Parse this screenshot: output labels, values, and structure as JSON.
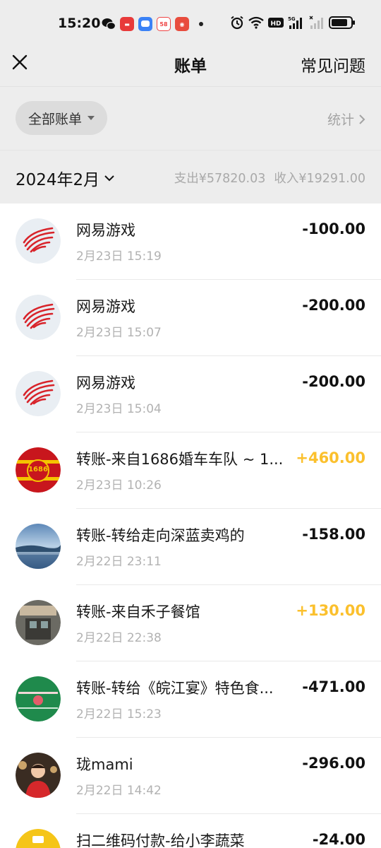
{
  "status_bar": {
    "time": "15:20",
    "left_icons": [
      "wechat-icon",
      "toutiao-icon",
      "message-icon",
      "58-app-icon",
      "weibo-icon"
    ],
    "right_icons": [
      "alarm-icon",
      "wifi-icon",
      "hd-icon",
      "signal-5g-icon",
      "signal-icon",
      "battery-icon"
    ],
    "hd_label": "HD",
    "fiveg_label": "5G",
    "battery_level": 0.85
  },
  "nav": {
    "title": "账单",
    "right_action": "常见问题"
  },
  "filter": {
    "chip_label": "全部账单",
    "stats_label": "统计"
  },
  "month": {
    "label": "2024年2月",
    "expense": "支出¥57820.03",
    "income": "收入¥19291.00"
  },
  "colors": {
    "background": "#ffffff",
    "header_bg": "#ededed",
    "income_amount": "#fbc02d",
    "netease_red": "#d8232a"
  },
  "bills": [
    {
      "title": "网易游戏",
      "time": "2月23日 15:19",
      "amount": "-100.00",
      "type": "expense",
      "avatar": "netease-logo"
    },
    {
      "title": "网易游戏",
      "time": "2月23日 15:07",
      "amount": "-200.00",
      "type": "expense",
      "avatar": "netease-logo"
    },
    {
      "title": "网易游戏",
      "time": "2月23日 15:04",
      "amount": "-200.00",
      "type": "expense",
      "avatar": "netease-logo"
    },
    {
      "title": "转账-来自1686婚车车队 ~ 1...",
      "time": "2月23日 10:26",
      "amount": "+460.00",
      "type": "income",
      "avatar": "wedding-car-avatar",
      "avatar_text": "1686"
    },
    {
      "title": "转账-转给走向深蓝卖鸡的",
      "time": "2月22日 23:11",
      "amount": "-158.00",
      "type": "expense",
      "avatar": "sea-photo-avatar"
    },
    {
      "title": "转账-来自禾子餐馆",
      "time": "2月22日 22:38",
      "amount": "+130.00",
      "type": "income",
      "avatar": "restaurant-photo-avatar"
    },
    {
      "title": "转账-转给《皖江宴》特色食...",
      "time": "2月22日 15:23",
      "amount": "-471.00",
      "type": "expense",
      "avatar": "green-shop-avatar"
    },
    {
      "title": "珑mami",
      "time": "2月22日 14:42",
      "amount": "-296.00",
      "type": "expense",
      "avatar": "person-photo-avatar"
    },
    {
      "title": "扫二维码付款-给小李蔬菜",
      "time": "",
      "amount": "-24.00",
      "type": "expense",
      "avatar": "yellow-qr-avatar"
    }
  ]
}
